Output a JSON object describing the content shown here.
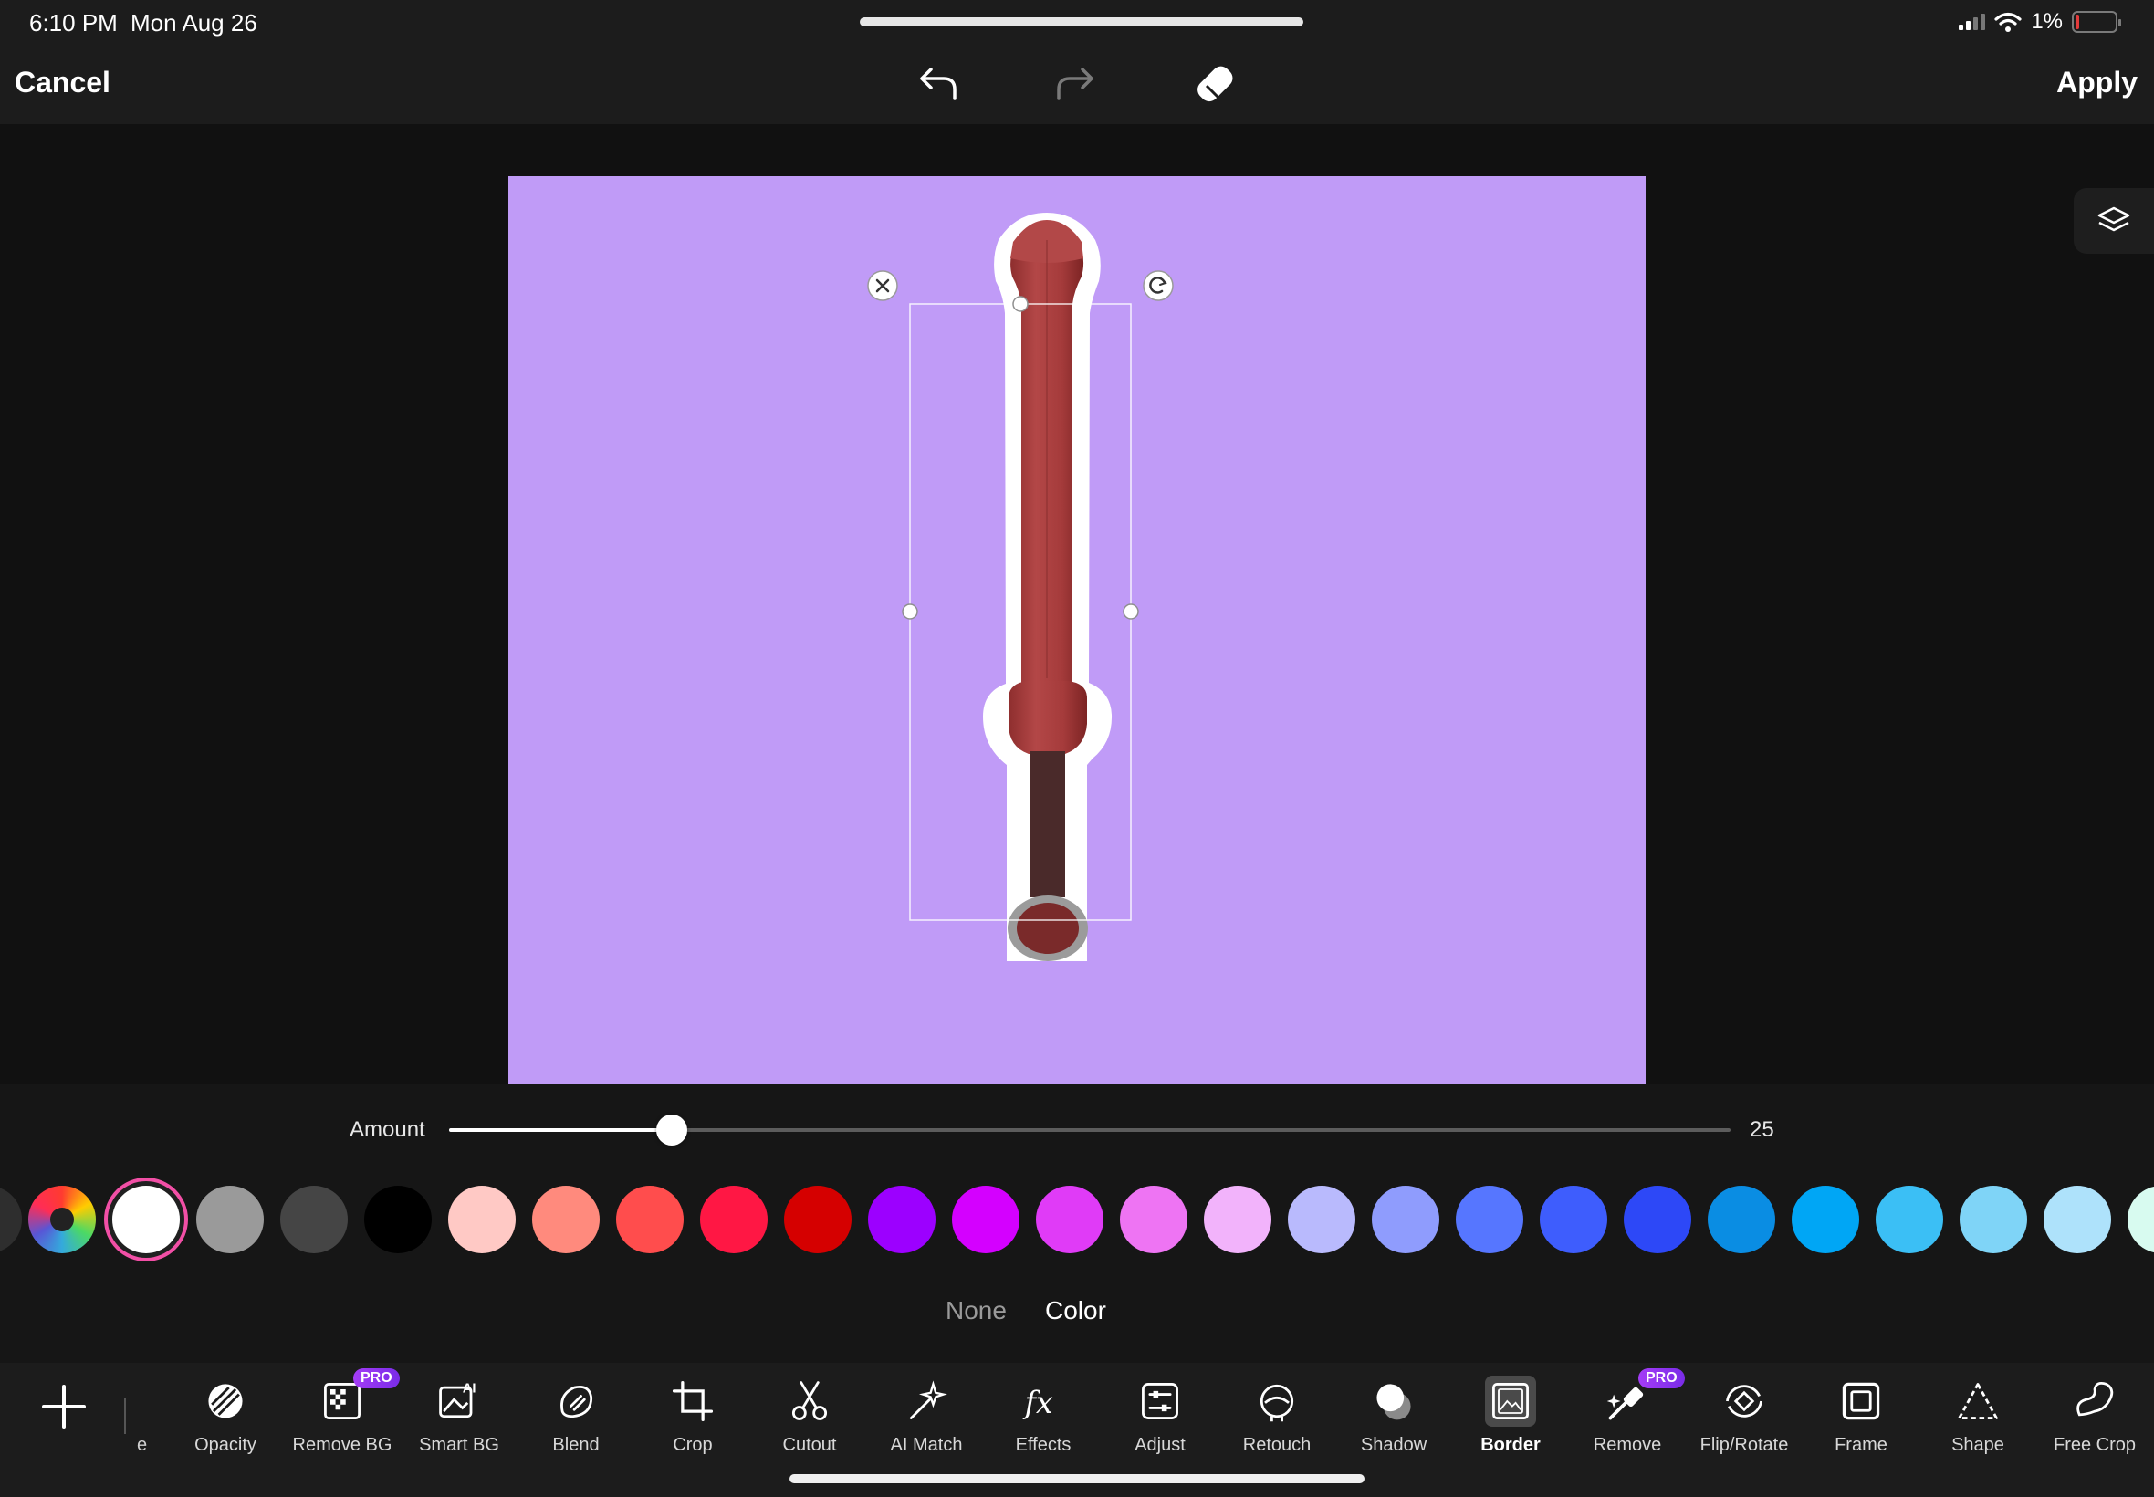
{
  "status": {
    "time": "6:10 PM",
    "date": "Mon Aug 26",
    "battery": "1%"
  },
  "topbar": {
    "cancel": "Cancel",
    "apply": "Apply"
  },
  "border": {
    "amount_label": "Amount",
    "amount_value": "25",
    "amount_fraction": 0.174,
    "modes": {
      "none": "None",
      "color": "Color"
    },
    "swatches": [
      "#ffffff",
      "#9a9a9a",
      "#454545",
      "#000000",
      "#ffc9c5",
      "#ff8a7d",
      "#ff4d4d",
      "#ff1744",
      "#d50000",
      "#9c00ff",
      "#d400ff",
      "#e03bf7",
      "#ee74f3",
      "#f2b3fb",
      "#b9bafd",
      "#8f9cfd",
      "#5676ff",
      "#3e5dfd",
      "#2d48f7",
      "#0a8de3",
      "#00a6f5",
      "#3bbff5",
      "#7fd4f7",
      "#aee2fb",
      "#d8fbf0"
    ],
    "selected_swatch": "#ffffff",
    "accent_color": "#f24fa6"
  },
  "canvas": {
    "background_color": "#c09bf7"
  },
  "toolbar": {
    "cut_label": "e",
    "tools": [
      {
        "label": "Opacity",
        "icon": "opacity-icon"
      },
      {
        "label": "Remove BG",
        "icon": "remove-bg-icon",
        "badge": "PRO"
      },
      {
        "label": "Smart BG",
        "icon": "smart-bg-icon"
      },
      {
        "label": "Blend",
        "icon": "blend-icon"
      },
      {
        "label": "Crop",
        "icon": "crop-icon"
      },
      {
        "label": "Cutout",
        "icon": "scissors-icon"
      },
      {
        "label": "AI Match",
        "icon": "ai-match-icon"
      },
      {
        "label": "Effects",
        "icon": "fx-icon"
      },
      {
        "label": "Adjust",
        "icon": "adjust-icon"
      },
      {
        "label": "Retouch",
        "icon": "retouch-icon"
      },
      {
        "label": "Shadow",
        "icon": "shadow-icon"
      },
      {
        "label": "Border",
        "icon": "border-icon",
        "active": true
      },
      {
        "label": "Remove",
        "icon": "magic-eraser-icon",
        "badge": "PRO"
      },
      {
        "label": "Flip/Rotate",
        "icon": "flip-rotate-icon"
      },
      {
        "label": "Frame",
        "icon": "frame-icon"
      },
      {
        "label": "Shape",
        "icon": "shape-icon"
      },
      {
        "label": "Free Crop",
        "icon": "free-crop-icon"
      }
    ]
  }
}
